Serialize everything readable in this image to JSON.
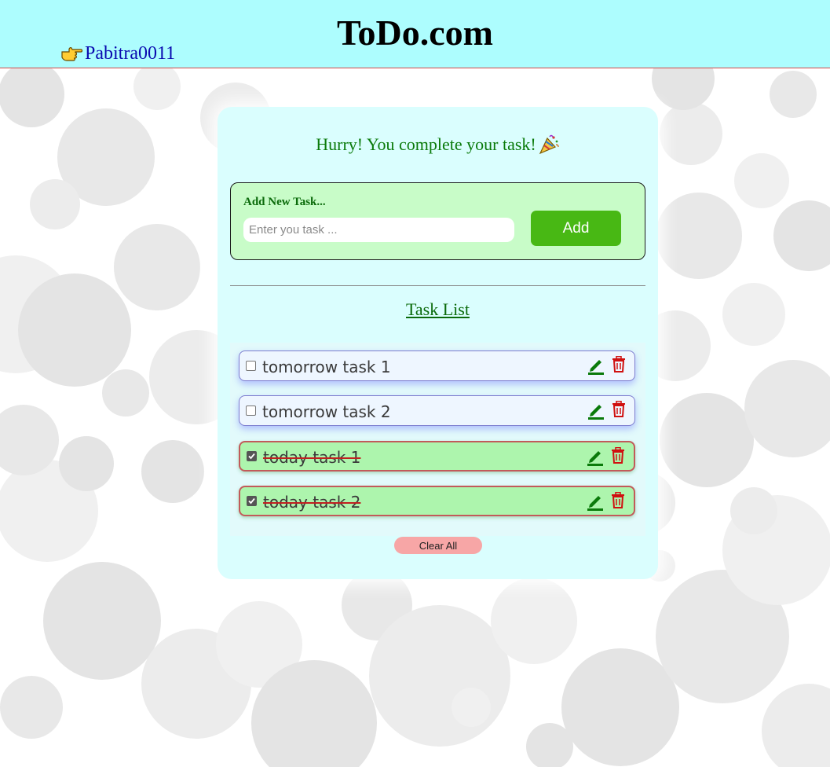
{
  "header": {
    "username": "Pabitra0011",
    "site_title": "ToDo.com",
    "pointer_icon": "pointing-hand-icon"
  },
  "card": {
    "motto": "Hurry! You complete your task!",
    "motto_icon": "party-popper-icon",
    "add_form": {
      "label": "Add New Task...",
      "input_placeholder": "Enter you task ...",
      "input_value": "",
      "add_button": "Add"
    },
    "list_title": "Task List",
    "tasks": [
      {
        "text": "tomorrow task 1",
        "completed": false
      },
      {
        "text": "tomorrow task 2",
        "completed": false
      },
      {
        "text": "today task 1",
        "completed": true
      },
      {
        "text": "today task 2",
        "completed": true
      }
    ],
    "clear_button": "Clear All"
  },
  "colors": {
    "header_bg": "#adfdfe",
    "card_bg": "#dafefe",
    "add_box_bg": "#c8fcc8",
    "add_button": "#48b814",
    "done_task_bg": "#adf5ad",
    "edit_icon": "#0a7a0a",
    "delete_icon": "#d01010",
    "clear_button": "#f7a6a6"
  }
}
